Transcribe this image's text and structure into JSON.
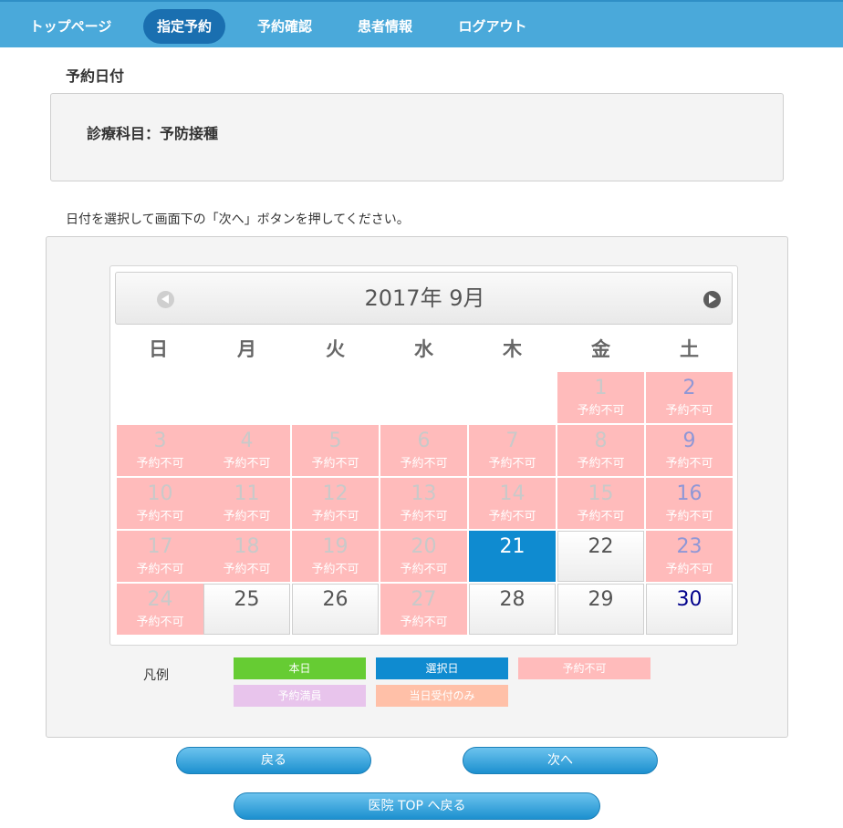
{
  "nav": {
    "items": [
      {
        "label": "トップページ"
      },
      {
        "label": "指定予約"
      },
      {
        "label": "予約確認"
      },
      {
        "label": "患者情報"
      },
      {
        "label": "ログアウト"
      }
    ]
  },
  "page_title": "予約日付",
  "department": "診療科目：予防接種",
  "instruction": "日付を選択して画面下の「次へ」ボタンを押してください。",
  "calendar": {
    "title": "2017年 9月",
    "weekdays": [
      "日",
      "月",
      "火",
      "水",
      "木",
      "金",
      "土"
    ],
    "unavailable_label": "予約不可",
    "days": [
      {
        "day": "1",
        "status": "予約不可"
      },
      {
        "day": "2",
        "status": "予約不可"
      },
      {
        "day": "3",
        "status": "予約不可"
      },
      {
        "day": "4",
        "status": "予約不可"
      },
      {
        "day": "5",
        "status": "予約不可"
      },
      {
        "day": "6",
        "status": "予約不可"
      },
      {
        "day": "7",
        "status": "予約不可"
      },
      {
        "day": "8",
        "status": "予約不可"
      },
      {
        "day": "9",
        "status": "予約不可"
      },
      {
        "day": "10",
        "status": "予約不可"
      },
      {
        "day": "11",
        "status": "予約不可"
      },
      {
        "day": "12",
        "status": "予約不可"
      },
      {
        "day": "13",
        "status": "予約不可"
      },
      {
        "day": "14",
        "status": "予約不可"
      },
      {
        "day": "15",
        "status": "予約不可"
      },
      {
        "day": "16",
        "status": "予約不可"
      },
      {
        "day": "17",
        "status": "予約不可"
      },
      {
        "day": "18",
        "status": "予約不可"
      },
      {
        "day": "19",
        "status": "予約不可"
      },
      {
        "day": "20",
        "status": "予約不可"
      },
      {
        "day": "21",
        "status": ""
      },
      {
        "day": "22",
        "status": ""
      },
      {
        "day": "23",
        "status": "予約不可"
      },
      {
        "day": "24",
        "status": "予約不可"
      },
      {
        "day": "25",
        "status": ""
      },
      {
        "day": "26",
        "status": ""
      },
      {
        "day": "27",
        "status": "予約不可"
      },
      {
        "day": "28",
        "status": ""
      },
      {
        "day": "29",
        "status": ""
      },
      {
        "day": "30",
        "status": ""
      }
    ],
    "selected_day": "21"
  },
  "legend": {
    "title": "凡例",
    "items": [
      {
        "label": "本日",
        "color": "#66cc33"
      },
      {
        "label": "選択日",
        "color": "#0f8bd0"
      },
      {
        "label": "予約不可",
        "color": "#ffbbbb"
      },
      {
        "label": "予約満員",
        "color": "#e8c4ec"
      },
      {
        "label": "当日受付のみ",
        "color": "#ffc0a8"
      }
    ]
  },
  "buttons": {
    "back": "戻る",
    "next": "次へ",
    "top": "医院 TOP へ戻る"
  },
  "colors": {
    "nav_bg": "#4aa9da",
    "nav_active": "#1a6fb0",
    "selected": "#0f8bd0",
    "unavailable": "#ffbbbb"
  }
}
